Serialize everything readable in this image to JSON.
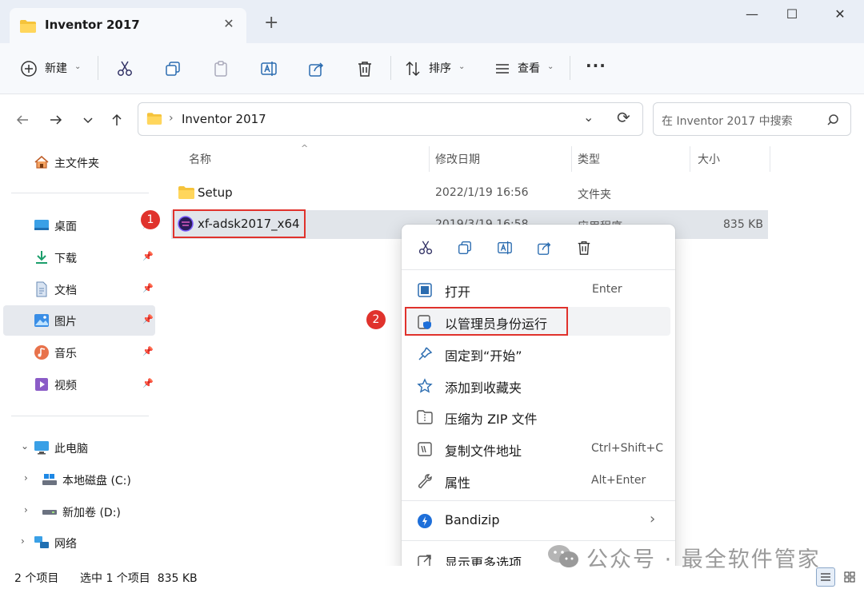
{
  "window": {
    "tab_title": "Inventor 2017",
    "tab_close": "✕",
    "new_tab": "+",
    "minimize": "—",
    "maximize": "☐",
    "close": "✕"
  },
  "toolbar": {
    "new_label": "新建",
    "sort_label": "排序",
    "view_label": "查看",
    "more": "···"
  },
  "address": {
    "path": "Inventor 2017",
    "separator": "›",
    "search_placeholder": "在 Inventor 2017 中搜索"
  },
  "sidebar": {
    "home": "主文件夹",
    "quick": [
      {
        "label": "桌面",
        "icon": "desktop-icon"
      },
      {
        "label": "下载",
        "icon": "download-icon"
      },
      {
        "label": "文档",
        "icon": "document-icon"
      },
      {
        "label": "图片",
        "icon": "pictures-icon"
      },
      {
        "label": "音乐",
        "icon": "music-icon"
      },
      {
        "label": "视频",
        "icon": "video-icon"
      }
    ],
    "this_pc": "此电脑",
    "drive_c": "本地磁盘 (C:)",
    "drive_d": "新加卷 (D:)",
    "network": "网络",
    "pin": "📌",
    "expand": "›"
  },
  "columns": {
    "name": "名称",
    "modified": "修改日期",
    "type": "类型",
    "size": "大小"
  },
  "files": [
    {
      "name": "Setup",
      "modified": "2022/1/19 16:56",
      "type": "文件夹",
      "size": ""
    },
    {
      "name": "xf-adsk2017_x64",
      "modified": "2019/3/19 16:58",
      "type": "应用程序",
      "size": "835 KB"
    }
  ],
  "context_menu": {
    "items": [
      {
        "label": "打开",
        "shortcut": "Enter"
      },
      {
        "label": "以管理员身份运行",
        "shortcut": ""
      },
      {
        "label": "固定到“开始”",
        "shortcut": ""
      },
      {
        "label": "添加到收藏夹",
        "shortcut": ""
      },
      {
        "label": "压缩为 ZIP 文件",
        "shortcut": ""
      },
      {
        "label": "复制文件地址",
        "shortcut": "Ctrl+Shift+C"
      },
      {
        "label": "属性",
        "shortcut": "Alt+Enter"
      }
    ],
    "bandizip": "Bandizip",
    "bandizip_arrow": "›",
    "more_options": "显示更多选项"
  },
  "badges": {
    "one": "1",
    "two": "2"
  },
  "status": {
    "count": "2 个项目",
    "selected": "选中 1 个项目  835 KB"
  },
  "watermark": {
    "text": "公众号 · 最全软件管家"
  },
  "colors": {
    "accent": "#0067c0",
    "highlight_red": "#e0322c",
    "folder": "#f5c33b"
  }
}
